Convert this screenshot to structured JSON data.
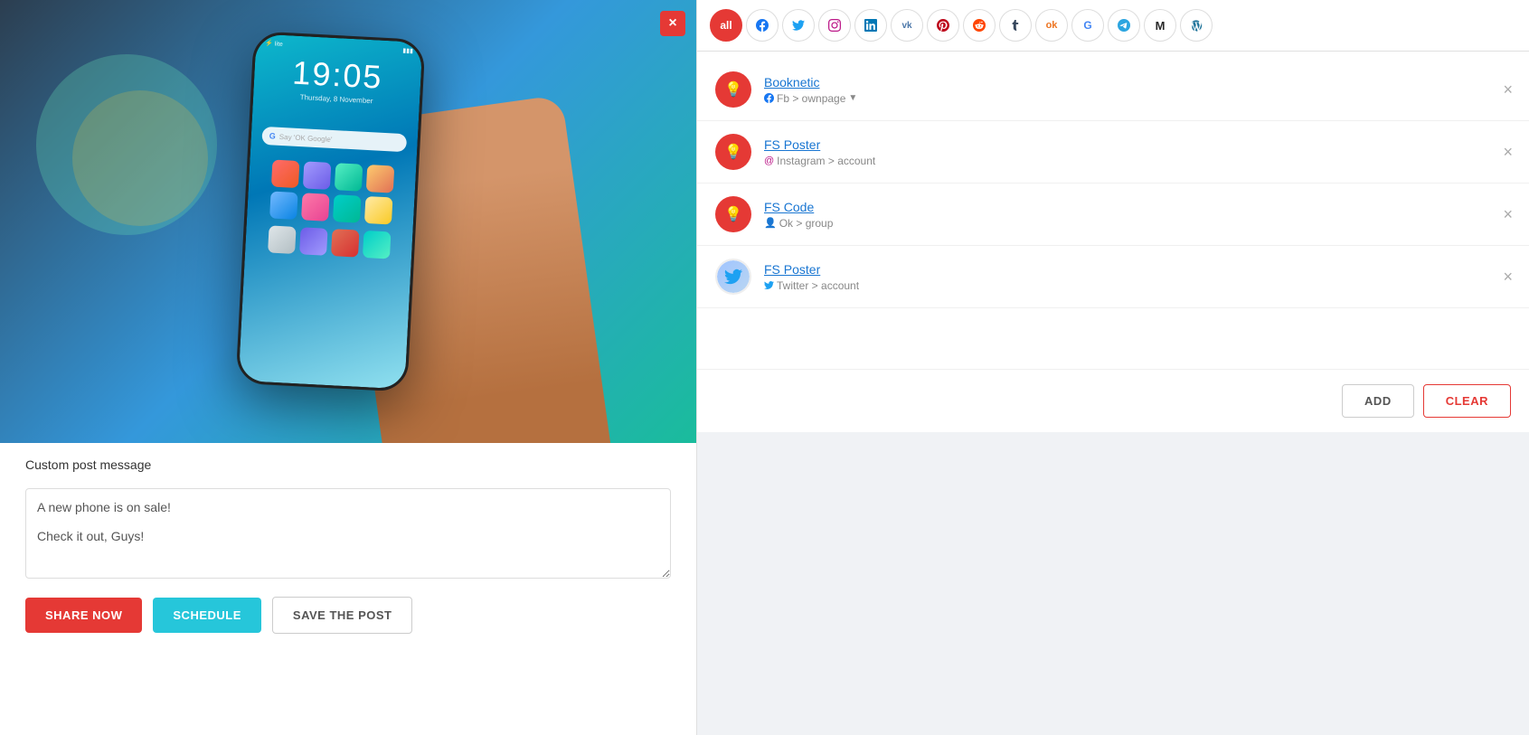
{
  "left_panel": {
    "custom_message_label": "Custom post message",
    "post_text": "A new phone is on sale!\n\nCheck it out, Guys!",
    "post_placeholder": "A new phone is on sale!\n\nCheck it out, Guys!",
    "close_button": "×",
    "share_now_label": "SHARE NOW",
    "schedule_label": "SCHEDULE",
    "save_post_label": "SAVE THE POST",
    "phone_time": "19:05",
    "phone_date": "Thursday, 8 November"
  },
  "right_panel": {
    "tabs": [
      {
        "id": "all",
        "label": "all",
        "active": true
      },
      {
        "id": "facebook",
        "label": "f",
        "icon": "facebook-icon"
      },
      {
        "id": "twitter",
        "label": "𝕋",
        "icon": "twitter-icon"
      },
      {
        "id": "instagram",
        "label": "📷",
        "icon": "instagram-icon"
      },
      {
        "id": "linkedin",
        "label": "in",
        "icon": "linkedin-icon"
      },
      {
        "id": "vk",
        "label": "vk",
        "icon": "vk-icon"
      },
      {
        "id": "pinterest",
        "label": "P",
        "icon": "pinterest-icon"
      },
      {
        "id": "reddit",
        "label": "r",
        "icon": "reddit-icon"
      },
      {
        "id": "tumblr",
        "label": "t",
        "icon": "tumblr-icon"
      },
      {
        "id": "ok",
        "label": "ok",
        "icon": "ok-icon"
      },
      {
        "id": "google",
        "label": "G",
        "icon": "google-icon"
      },
      {
        "id": "telegram",
        "label": "✈",
        "icon": "telegram-icon"
      },
      {
        "id": "medium",
        "label": "M",
        "icon": "medium-icon"
      },
      {
        "id": "wordpress",
        "label": "W",
        "icon": "wordpress-icon"
      }
    ],
    "accounts": [
      {
        "id": "booknetic",
        "name": "Booknetic",
        "avatar_color": "#e53935",
        "avatar_icon": "💡",
        "platform_icon": "facebook-icon",
        "platform_symbol": "f",
        "path": "Fb > ownpage",
        "filter_icon": "▼",
        "network": "fb"
      },
      {
        "id": "fs-poster-instagram",
        "name": "FS Poster",
        "avatar_color": "#e53935",
        "avatar_icon": "💡",
        "platform_icon": "instagram-icon",
        "platform_symbol": "@",
        "path": "Instagram > account",
        "filter_icon": "",
        "network": "instagram"
      },
      {
        "id": "fs-code",
        "name": "FS Code",
        "avatar_color": "#e53935",
        "avatar_icon": "💡",
        "platform_icon": "ok-icon",
        "platform_symbol": "👤",
        "path": "Ok > group",
        "filter_icon": "",
        "network": "ok"
      },
      {
        "id": "fs-poster-twitter",
        "name": "FS Poster",
        "avatar_color": "#fff",
        "avatar_icon": "🐦",
        "platform_icon": "twitter-icon",
        "platform_symbol": "🐦",
        "path": "Twitter > account",
        "filter_icon": "",
        "network": "twitter"
      }
    ],
    "add_button_label": "ADD",
    "clear_button_label": "CLEAR"
  }
}
